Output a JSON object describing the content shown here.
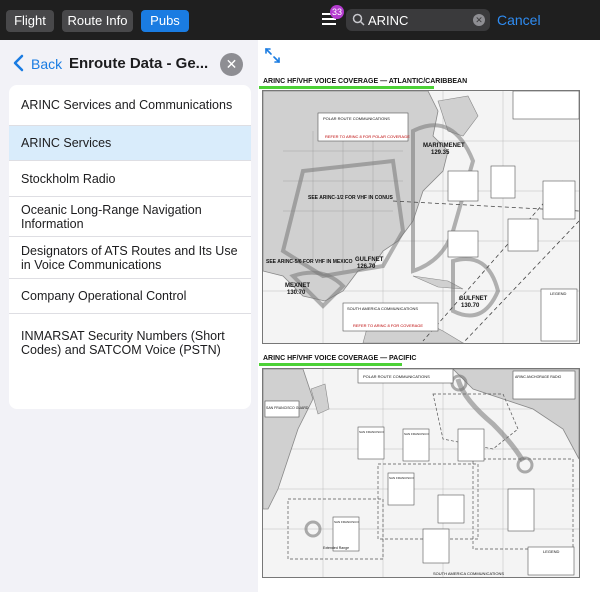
{
  "topbar": {
    "tabs": [
      {
        "label": "Flight",
        "active": false
      },
      {
        "label": "Route Info",
        "active": false
      },
      {
        "label": "Pubs",
        "active": true
      }
    ],
    "badge_count": "33",
    "search": {
      "value": "ARINC"
    },
    "cancel_label": "Cancel",
    "accent": "#1a7ce2"
  },
  "sidebar": {
    "back_label": "Back",
    "title": "Enroute Data - Ge...",
    "items": [
      {
        "label": "ARINC Services and Communications",
        "selected": false
      },
      {
        "label": "ARINC Services",
        "selected": true
      },
      {
        "label": "Stockholm Radio",
        "selected": false
      },
      {
        "label": "Oceanic Long-Range Navigation Information",
        "selected": false
      },
      {
        "label": "Designators of ATS Routes and Its Use in Voice Communications",
        "selected": false
      },
      {
        "label": "Company Operational Control",
        "selected": false
      },
      {
        "label": "INMARSAT Security Numbers (Short Codes) and SATCOM Voice (PSTN)",
        "selected": false
      }
    ]
  },
  "document": {
    "charts": [
      {
        "title": "ARINC HF/VHF VOICE COVERAGE — ATLANTIC/CARIBBEAN",
        "labels": {
          "polar": "POLAR ROUTE COMMUNICATIONS",
          "refer_polar": "REFER TO ARINC 8 FOR POLAR COVERAGE",
          "maritimenet": "MARITIMENET",
          "maritimenet_freq": "129.35",
          "conus": "SEE ARINC-1/2 FOR VHF IN CONUS",
          "mexico": "SEE ARINC-5/6 FOR VHF IN MEXICO",
          "gulfnet": "GULFNET",
          "gulfnet_freq": "126.70",
          "mexnet": "MEXNET",
          "mexnet_freq": "130.70",
          "gulfnet2": "GULFNET",
          "gulfnet2_freq": "130.70",
          "south_america": "SOUTH AMERICA COMMUNICATIONS",
          "refer_sa": "REFER TO ARINC 8 FOR COVERAGE",
          "legend": "LEGEND"
        }
      },
      {
        "title": "ARINC HF/VHF VOICE COVERAGE — PACIFIC",
        "labels": {
          "polar": "POLAR ROUTE COMMUNICATIONS",
          "sf_guard": "SAN FRANCISCO GUARD",
          "anchorage": "ARINC ANCHORAGE RADIO",
          "sf1": "SAN FRANCISCO",
          "sf2": "SAN FRANCISCO",
          "sf3": "SAN FRANCISCO",
          "sf4": "SAN FRANCISCO",
          "extended": "Extended Range",
          "south_america": "SOUTH AMERICA COMMUNICATIONS",
          "legend": "LEGEND"
        }
      }
    ]
  }
}
